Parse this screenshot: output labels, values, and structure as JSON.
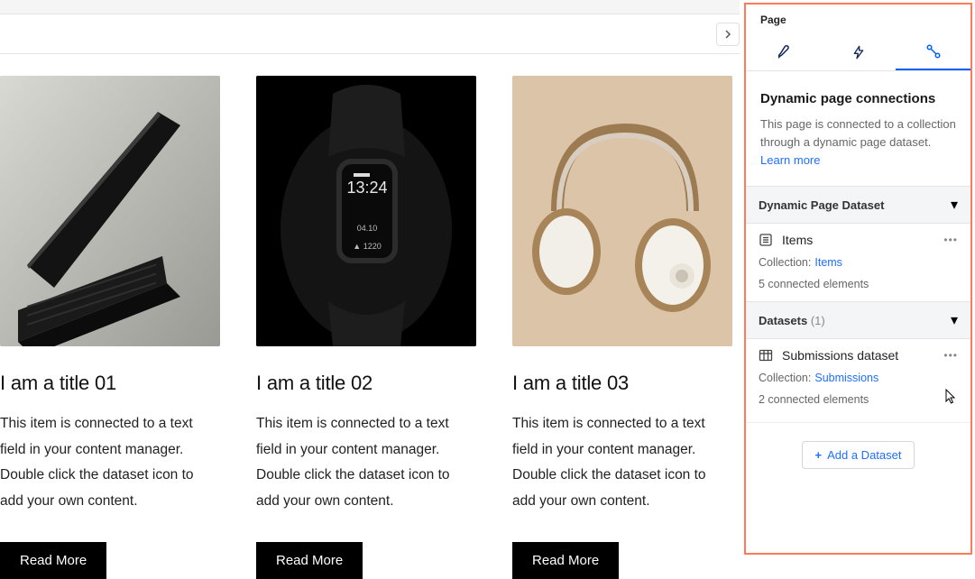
{
  "cards": [
    {
      "title": "I am a title 01",
      "desc": "This item is connected to a text field in your content manager. Double click the dataset icon to add your own content.",
      "cta": "Read More"
    },
    {
      "title": "I am a title 02",
      "desc": "This item is connected to a text field in your content manager. Double click the dataset icon to add your own content.",
      "cta": "Read More"
    },
    {
      "title": "I am a title 03",
      "desc": "This item is connected to a text field in your content manager. Double click the dataset icon to add your own content.",
      "cta": "Read More"
    }
  ],
  "panel": {
    "header": "Page",
    "section_title": "Dynamic page connections",
    "section_desc": "This page is connected to a collection through a dynamic page dataset. ",
    "learn_more": "Learn more",
    "group1": {
      "title": "Dynamic Page Dataset",
      "item_name": "Items",
      "collection_label": "Collection:",
      "collection_link": "Items",
      "connected": "5 connected elements"
    },
    "group2": {
      "title": "Datasets",
      "count": "(1)",
      "item_name": "Submissions dataset",
      "collection_label": "Collection:",
      "collection_link": "Submissions",
      "connected": "2 connected elements"
    },
    "add_dataset": "Add a Dataset"
  }
}
